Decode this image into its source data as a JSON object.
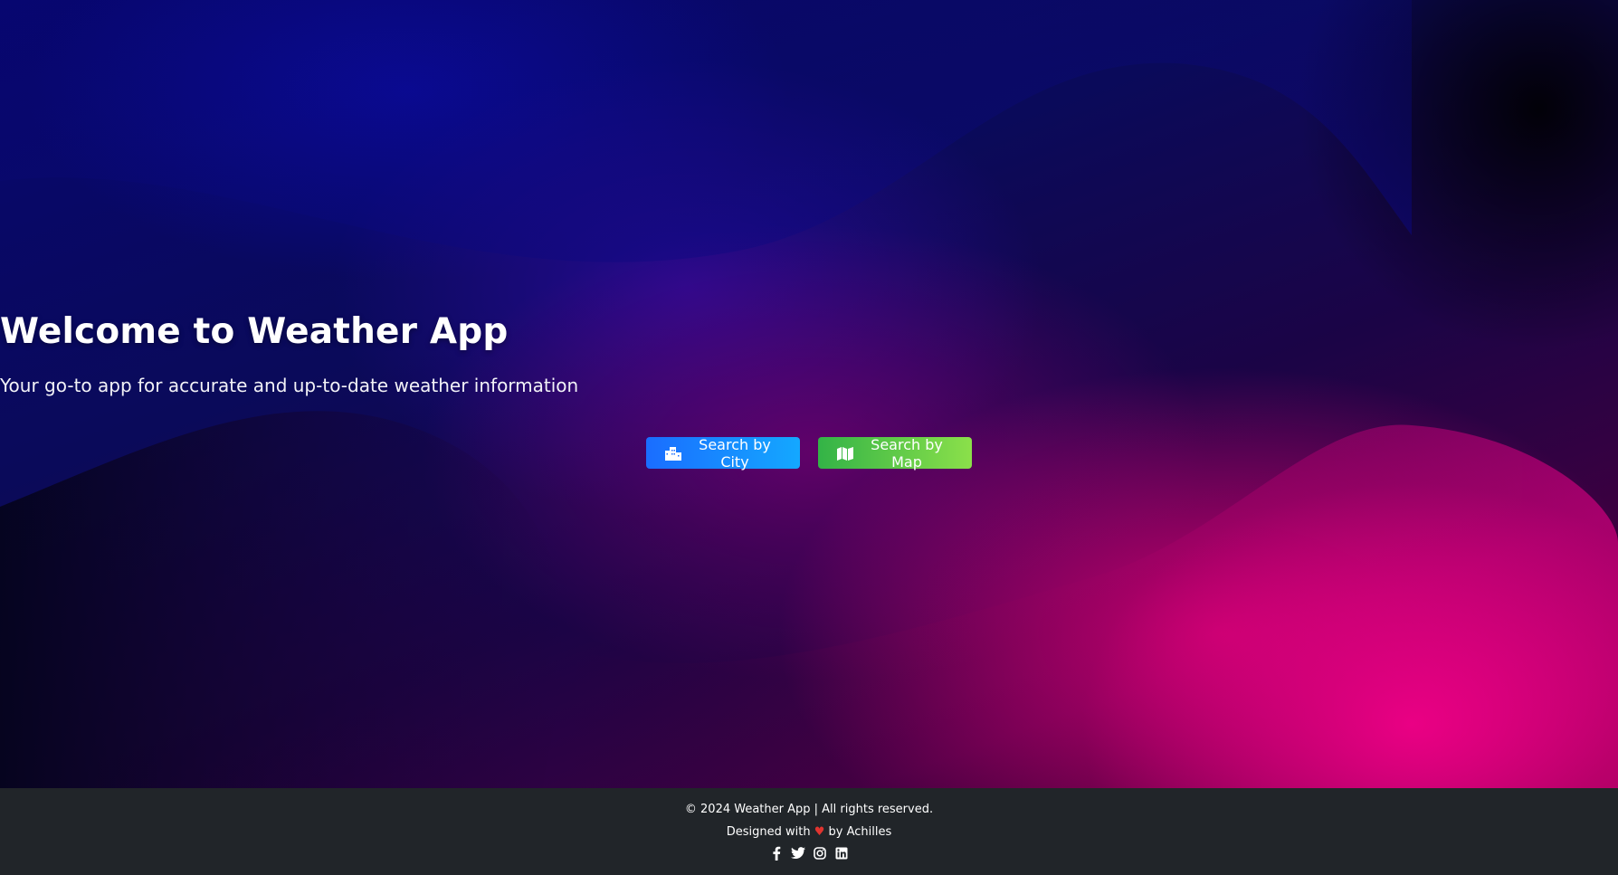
{
  "hero": {
    "title": "Welcome to Weather App",
    "subtitle": "Your go-to app for accurate and up-to-date weather information",
    "buttons": {
      "city": {
        "label": "Search by City",
        "icon": "city-icon"
      },
      "map": {
        "label": "Search by Map",
        "icon": "map-icon"
      }
    }
  },
  "footer": {
    "copyright": "© 2024 Weather App | All rights reserved.",
    "designed_prefix": "Designed with",
    "heart": "♥",
    "designed_suffix": "by Achilles",
    "social": [
      "facebook-icon",
      "twitter-icon",
      "instagram-icon",
      "linkedin-icon"
    ]
  },
  "colors": {
    "city_button": "#1a6dff",
    "map_button": "#33b347",
    "footer_bg": "#212529",
    "heart": "#e0342f"
  }
}
